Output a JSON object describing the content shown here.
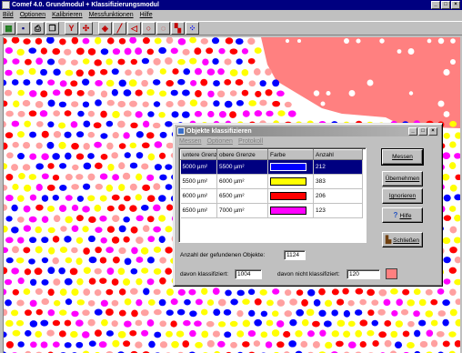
{
  "app": {
    "title": "Comef 4.0. Grundmodul + Klassifizierungsmodul",
    "title_buttons": [
      "_",
      "□",
      "×"
    ]
  },
  "menu": [
    "Bild",
    "Optionen",
    "Kalibrieren",
    "Messfunktionen",
    "Hilfe"
  ],
  "toolbar": {
    "tools": [
      {
        "icon": "grid-icon",
        "glyph": "▦"
      },
      {
        "icon": "save-icon",
        "glyph": "▪"
      },
      {
        "icon": "print-icon",
        "glyph": "⎙"
      },
      {
        "icon": "copy-icon",
        "glyph": "❐"
      },
      {
        "icon": "measure-icon",
        "glyph": "Y"
      },
      {
        "icon": "crosshair-icon",
        "glyph": "✣"
      },
      {
        "icon": "fill-icon",
        "glyph": "◈"
      },
      {
        "icon": "line-icon",
        "glyph": "╱"
      },
      {
        "icon": "angle-icon",
        "glyph": "◁"
      },
      {
        "icon": "circle-icon",
        "glyph": "○"
      },
      {
        "icon": "freehand-icon",
        "glyph": "◌"
      },
      {
        "icon": "classify-icon",
        "glyph": "▚"
      },
      {
        "icon": "particles-icon",
        "glyph": "⁘"
      }
    ]
  },
  "dialog": {
    "title": "Objekte klassifizieren",
    "title_buttons": [
      "_",
      "□",
      "×"
    ],
    "menu": [
      "Messen",
      "Optionen",
      "Protokoll"
    ],
    "table": {
      "headers": [
        "untere Grenze",
        "obere Grenze",
        "Farbe",
        "Anzahl"
      ],
      "rows": [
        {
          "lower": "5000 µm²",
          "upper": "5500 µm²",
          "color": "#0000ff",
          "count": "212"
        },
        {
          "lower": "5500 µm²",
          "upper": "6000 µm²",
          "color": "#ffff00",
          "count": "383"
        },
        {
          "lower": "6000 µm²",
          "upper": "6500 µm²",
          "color": "#ff0000",
          "count": "206"
        },
        {
          "lower": "6500 µm²",
          "upper": "7000 µm²",
          "color": "#ff00ff",
          "count": "123"
        }
      ]
    },
    "buttons": {
      "measure": "Messen",
      "accept": "Übernehmen",
      "ignore": "Ignorieren",
      "help": "Hilfe",
      "close": "Schließen"
    },
    "found_label": "Anzahl der gefundenen Objekte:",
    "found_value": "1124",
    "classified_label": "davon klassifiziert:",
    "classified_value": "1004",
    "unclassified_label": "davon nicht klassifiziert:",
    "unclassified_value": "120",
    "unclassified_color": "#ff8080"
  },
  "image": {
    "background_region_color": "#ff8080",
    "dot_colors": [
      "#0000ff",
      "#ffff00",
      "#ff0000",
      "#ff00ff",
      "#ffa0a0"
    ]
  }
}
